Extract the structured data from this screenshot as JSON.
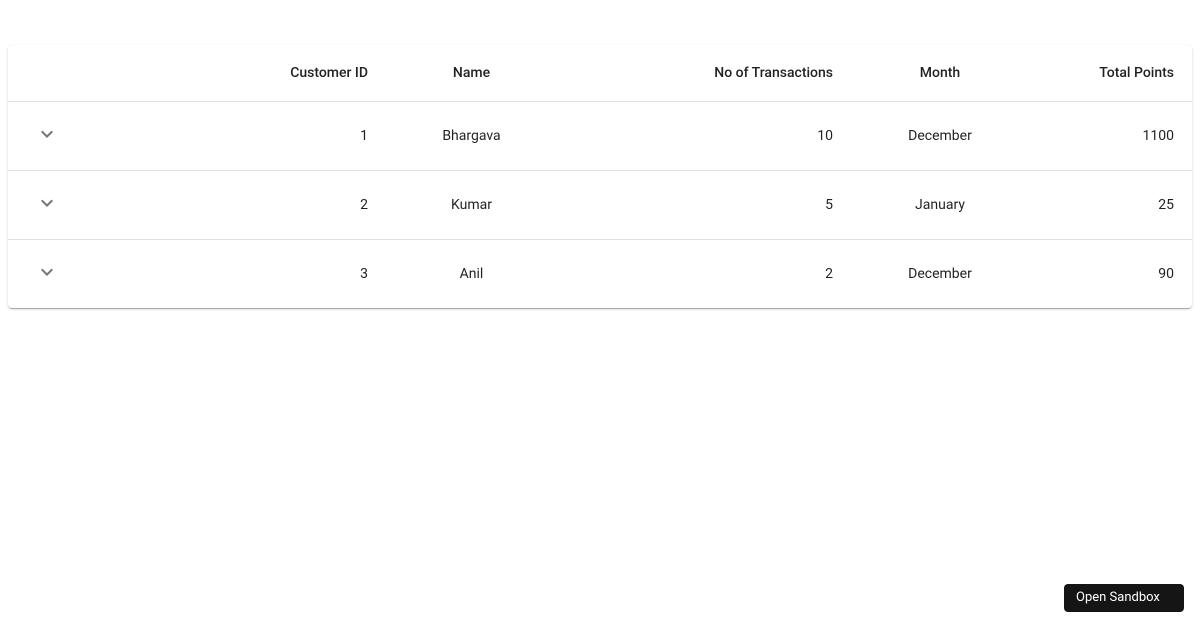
{
  "table": {
    "headers": {
      "customer_id": "Customer ID",
      "name": "Name",
      "transactions": "No of Transactions",
      "month": "Month",
      "points": "Total Points"
    },
    "rows": [
      {
        "customer_id": "1",
        "name": "Bhargava",
        "transactions": "10",
        "month": "December",
        "points": "1100"
      },
      {
        "customer_id": "2",
        "name": "Kumar",
        "transactions": "5",
        "month": "January",
        "points": "25"
      },
      {
        "customer_id": "3",
        "name": "Anil",
        "transactions": "2",
        "month": "December",
        "points": "90"
      }
    ]
  },
  "sandbox_button": "Open Sandbox"
}
